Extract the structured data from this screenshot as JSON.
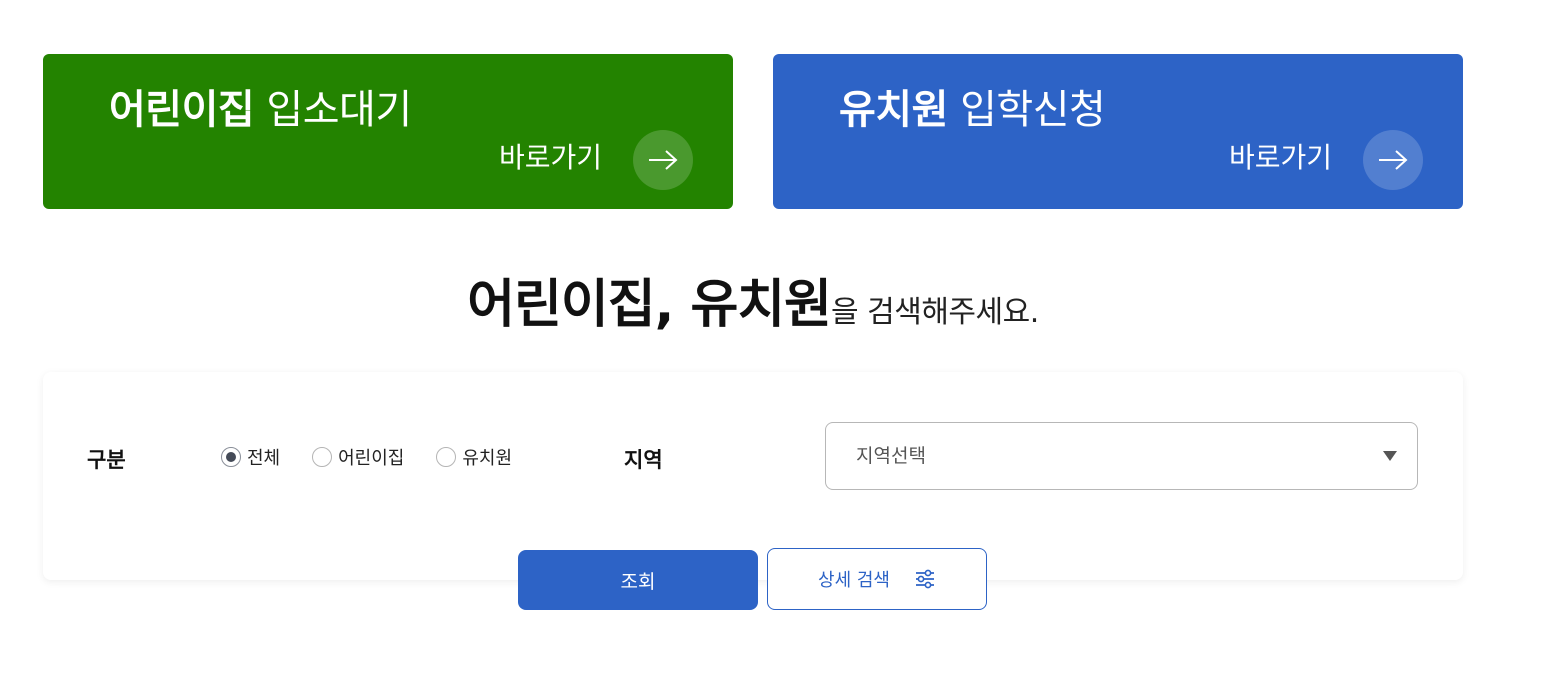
{
  "banners": {
    "daycare": {
      "title_strong": "어린이집",
      "title_light": " 입소대기",
      "link_label": "바로가기",
      "icon": "arrow-right-icon",
      "color": "#238300"
    },
    "kindergarten": {
      "title_strong": "유치원",
      "title_light": " 입학신청",
      "link_label": "바로가기",
      "icon": "arrow-right-icon",
      "color": "#2d63c6"
    }
  },
  "heading": {
    "strong": "어린이집, 유치원",
    "light": "을 검색해주세요."
  },
  "search": {
    "category_label": "구분",
    "category_options": [
      {
        "label": "전체",
        "checked": true
      },
      {
        "label": "어린이집",
        "checked": false
      },
      {
        "label": "유치원",
        "checked": false
      }
    ],
    "region_label": "지역",
    "region_select": {
      "selected": "지역선택",
      "icon": "caret-down-icon"
    },
    "submit_label": "조회",
    "detail_label": "상세 검색",
    "detail_icon": "sliders-icon"
  },
  "colors": {
    "green": "#238300",
    "blue": "#2d63c6"
  }
}
